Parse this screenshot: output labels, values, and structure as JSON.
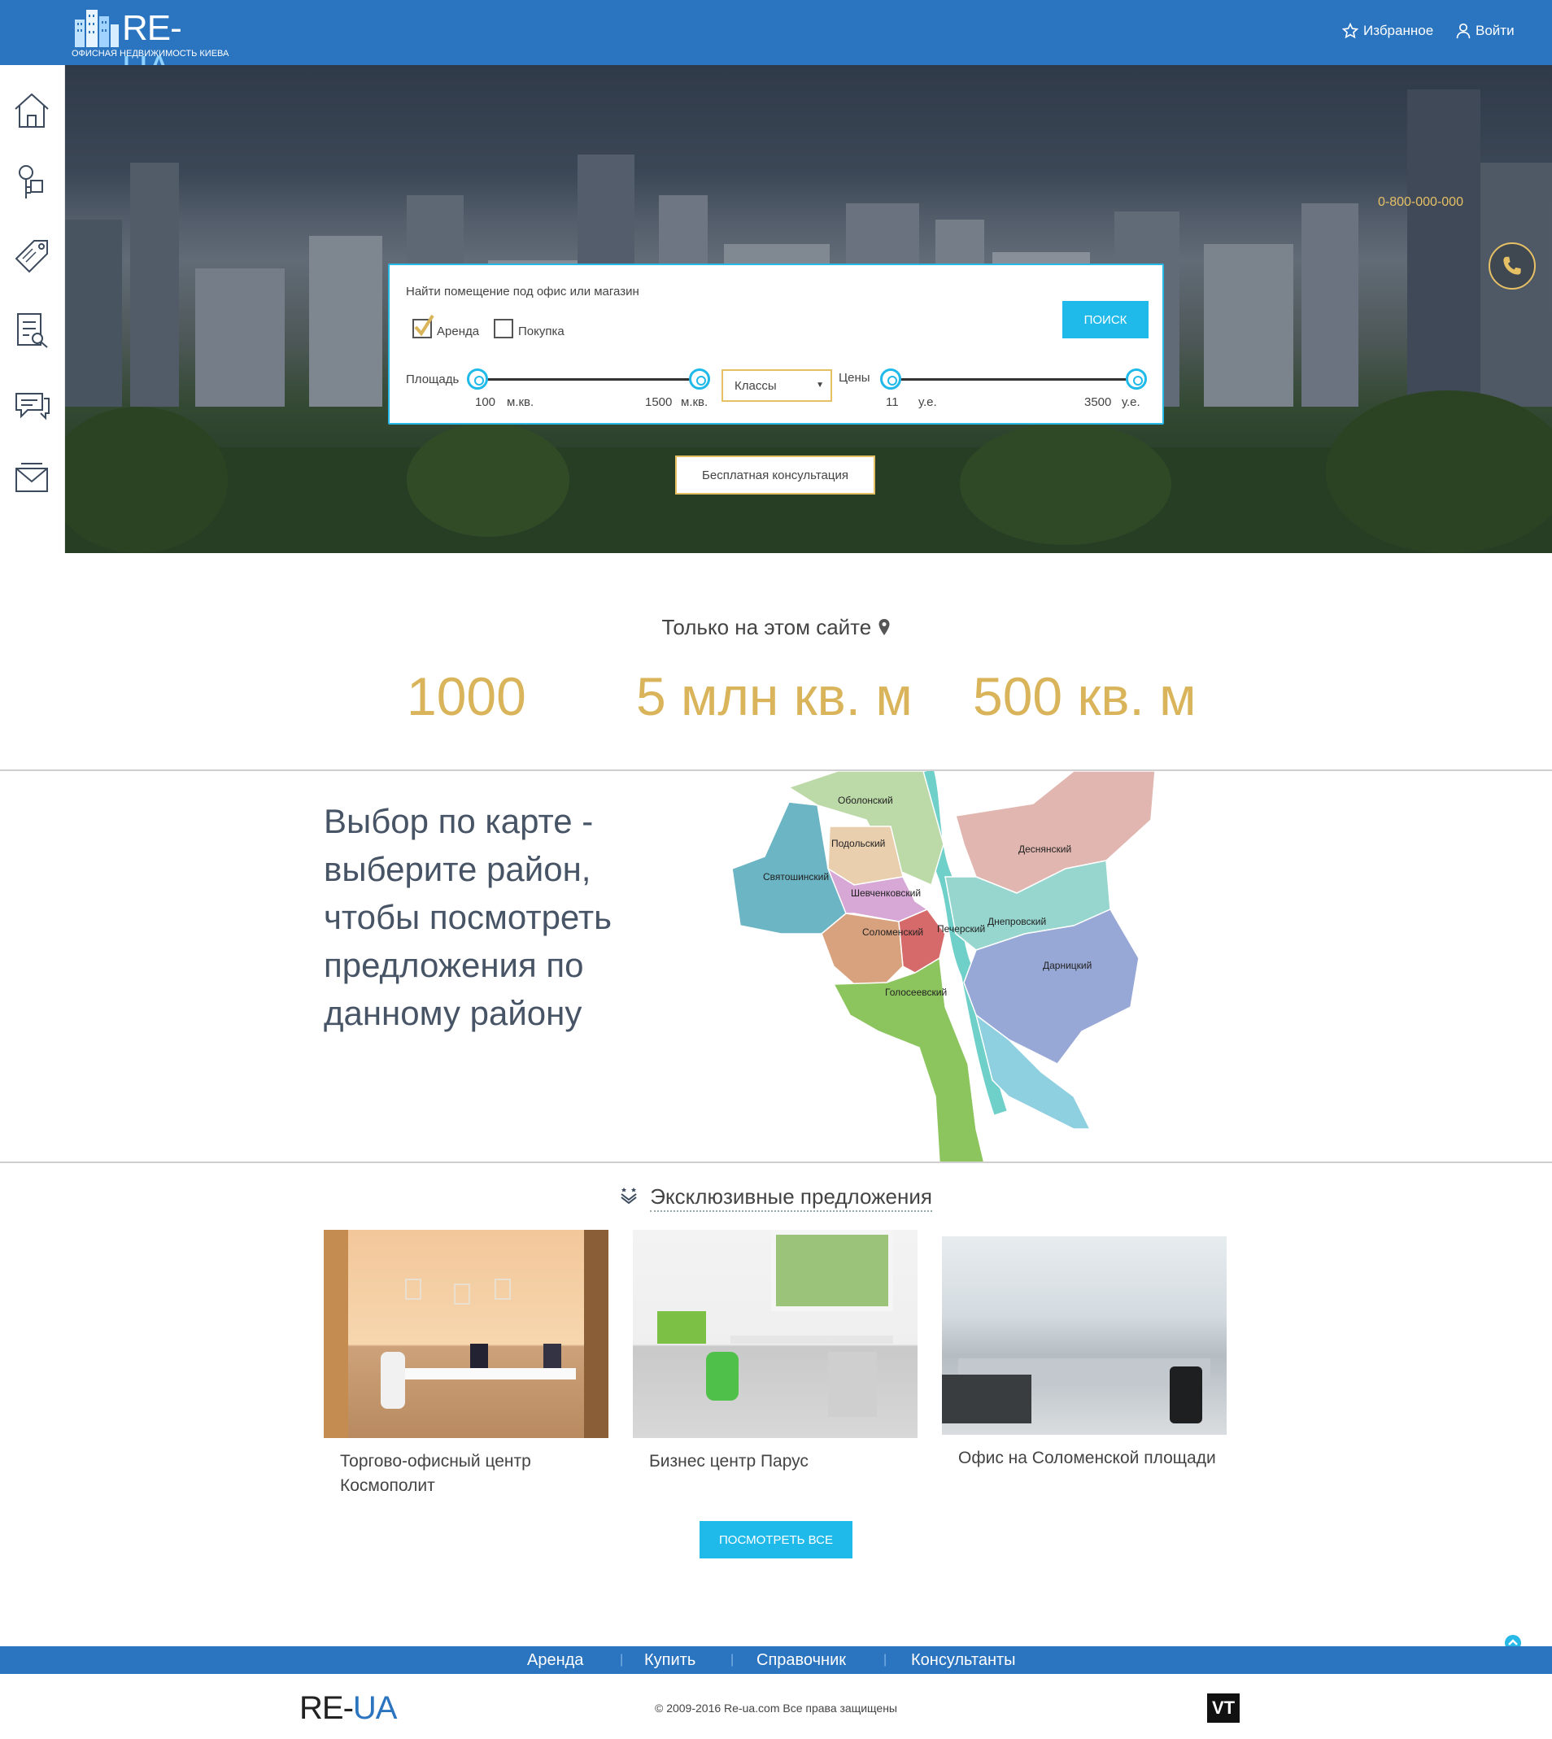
{
  "header": {
    "brand_main": "RE-",
    "brand_accent": "UA",
    "tagline": "ОФИСНАЯ НЕДВИЖИМОСТЬ КИЕВА",
    "favorites_label": "Избранное",
    "login_label": "Войти"
  },
  "sidebar": {
    "items": [
      {
        "icon": "home-icon"
      },
      {
        "icon": "keys-icon"
      },
      {
        "icon": "price-tag-icon"
      },
      {
        "icon": "checklist-icon"
      },
      {
        "icon": "chat-icon"
      },
      {
        "icon": "envelope-icon"
      }
    ]
  },
  "hero": {
    "phone": "0-800-000-000",
    "consult_button": "Бесплатная консультация"
  },
  "search": {
    "title": "Найти помещение под офис или магазин",
    "rent_label": "Аренда",
    "rent_checked": true,
    "buy_label": "Покупка",
    "buy_checked": false,
    "submit_label": "ПОИСК",
    "area_label": "Площадь",
    "area_min": "100",
    "area_max": "1500",
    "area_unit": "м.кв.",
    "classes_label": "Классы",
    "price_label": "Цены",
    "price_min": "11",
    "price_max": "3500",
    "price_unit": "у.е."
  },
  "stats": {
    "title": "Только на этом сайте",
    "values": [
      "1000",
      "5 млн кв. м",
      "500 кв. м"
    ]
  },
  "map_section": {
    "text": "Выбор по карте - выберите район, чтобы посмотреть предложения по данному району",
    "districts": [
      {
        "name": "Оболонский",
        "color": "#bcd9a8"
      },
      {
        "name": "Подольский",
        "color": "#e9cfae"
      },
      {
        "name": "Святошинский",
        "color": "#6cb5c4"
      },
      {
        "name": "Шевченковский",
        "color": "#d7a7d6"
      },
      {
        "name": "Соломенский",
        "color": "#d9a27f"
      },
      {
        "name": "Печерский",
        "color": "#d66a6a"
      },
      {
        "name": "Голосеевский",
        "color": "#8cc45e"
      },
      {
        "name": "Деснянский",
        "color": "#e1b6b0"
      },
      {
        "name": "Днепровский",
        "color": "#96d6ce"
      },
      {
        "name": "Дарницкий",
        "color": "#98a8d6"
      }
    ]
  },
  "offers": {
    "title": "Эксклюзивные предложения",
    "items": [
      {
        "title": "Торгово-офисный центр Космополит"
      },
      {
        "title": "Бизнес центр Парус"
      },
      {
        "title": "Офис на Соломенской площади"
      }
    ],
    "view_all_label": "ПОСМОТРЕТЬ ВСЕ"
  },
  "footer": {
    "nav": [
      "Аренда",
      "Купить",
      "Справочник",
      "Консультанты"
    ],
    "separator": "|",
    "copyright": "© 2009-2016 Re-ua.com Все права защищены",
    "brand_main": "RE-",
    "brand_accent": "UA",
    "partner_logo": "VT"
  },
  "colors": {
    "header_bg": "#2a74c0",
    "accent_cyan": "#1fb9ea",
    "gold": "#d9b45a"
  }
}
